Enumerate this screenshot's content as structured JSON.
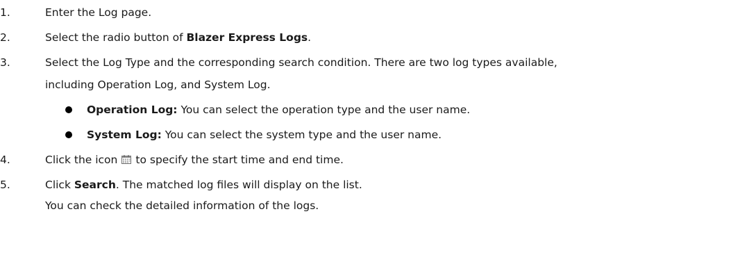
{
  "steps": [
    {
      "num": "1.",
      "text": "Enter the Log page."
    },
    {
      "num": "2.",
      "pre": "Select the radio button of ",
      "bold": "Blazer Express Logs",
      "post": "."
    },
    {
      "num": "3.",
      "line1": "Select the Log Type and the corresponding search condition. There are two log types available,",
      "line2": "including Operation Log, and System Log."
    },
    {
      "num": "4.",
      "pre": "Click the icon",
      "post": "to specify the start time and end time."
    },
    {
      "num": "5.",
      "pre": "Click ",
      "bold": "Search",
      "post": ". The matched log files will display on the list.",
      "line2": "You can check the detailed information of the logs."
    }
  ],
  "bullets": [
    {
      "bold": "Operation Log:",
      "text": " You can select the operation type and the user name."
    },
    {
      "bold": "System Log:",
      "text": " You can select the system type and the user name."
    }
  ],
  "icons": {
    "calendar": "calendar-icon",
    "bullet": "bullet-dot"
  }
}
